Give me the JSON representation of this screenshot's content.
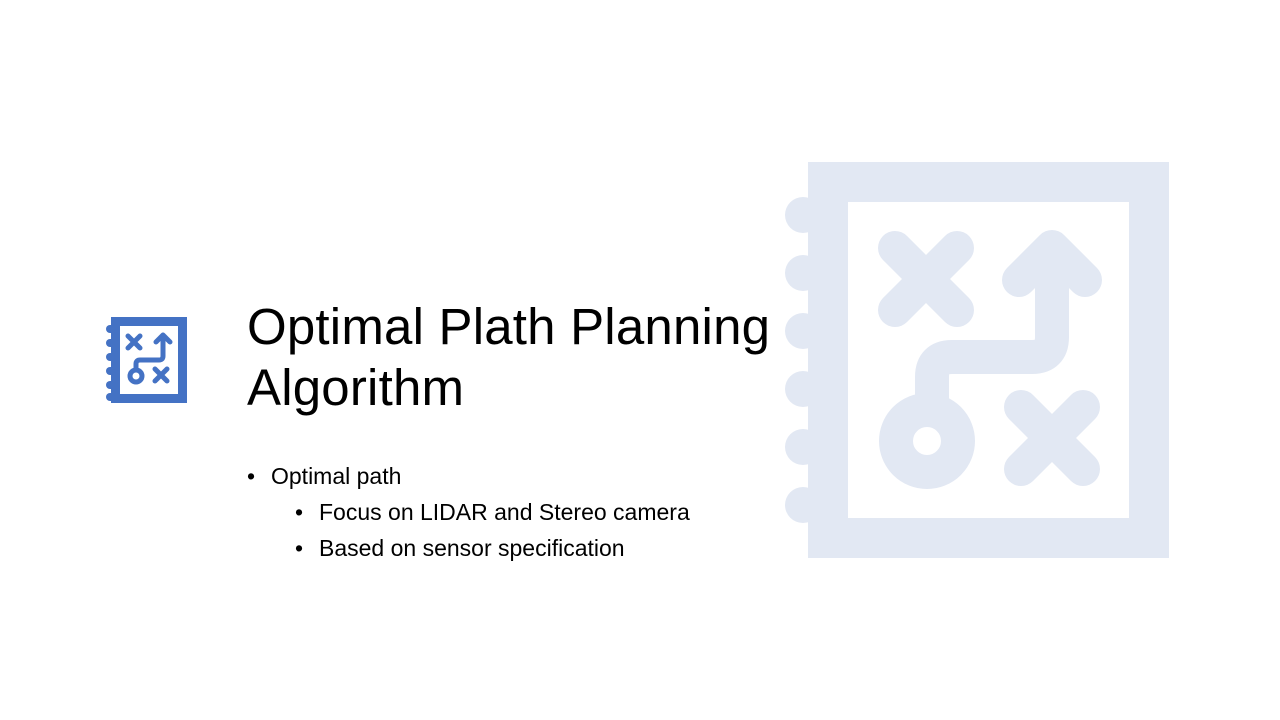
{
  "slide": {
    "title_line1": "Optimal Plath Planning",
    "title_line2": "Algorithm",
    "bullets": [
      {
        "label": "Optimal path",
        "level": 1
      },
      {
        "label": "Focus on LIDAR and Stereo camera",
        "level": 2
      },
      {
        "label": "Based on sensor specification",
        "level": 2
      }
    ]
  },
  "icons": {
    "primary": "strategy-notebook-icon",
    "background": "strategy-notebook-watermark-icon"
  },
  "colors": {
    "icon_blue": "#4472C4",
    "watermark_blue": "#E2E8F3",
    "text": "#000000",
    "background": "#FFFFFF"
  }
}
